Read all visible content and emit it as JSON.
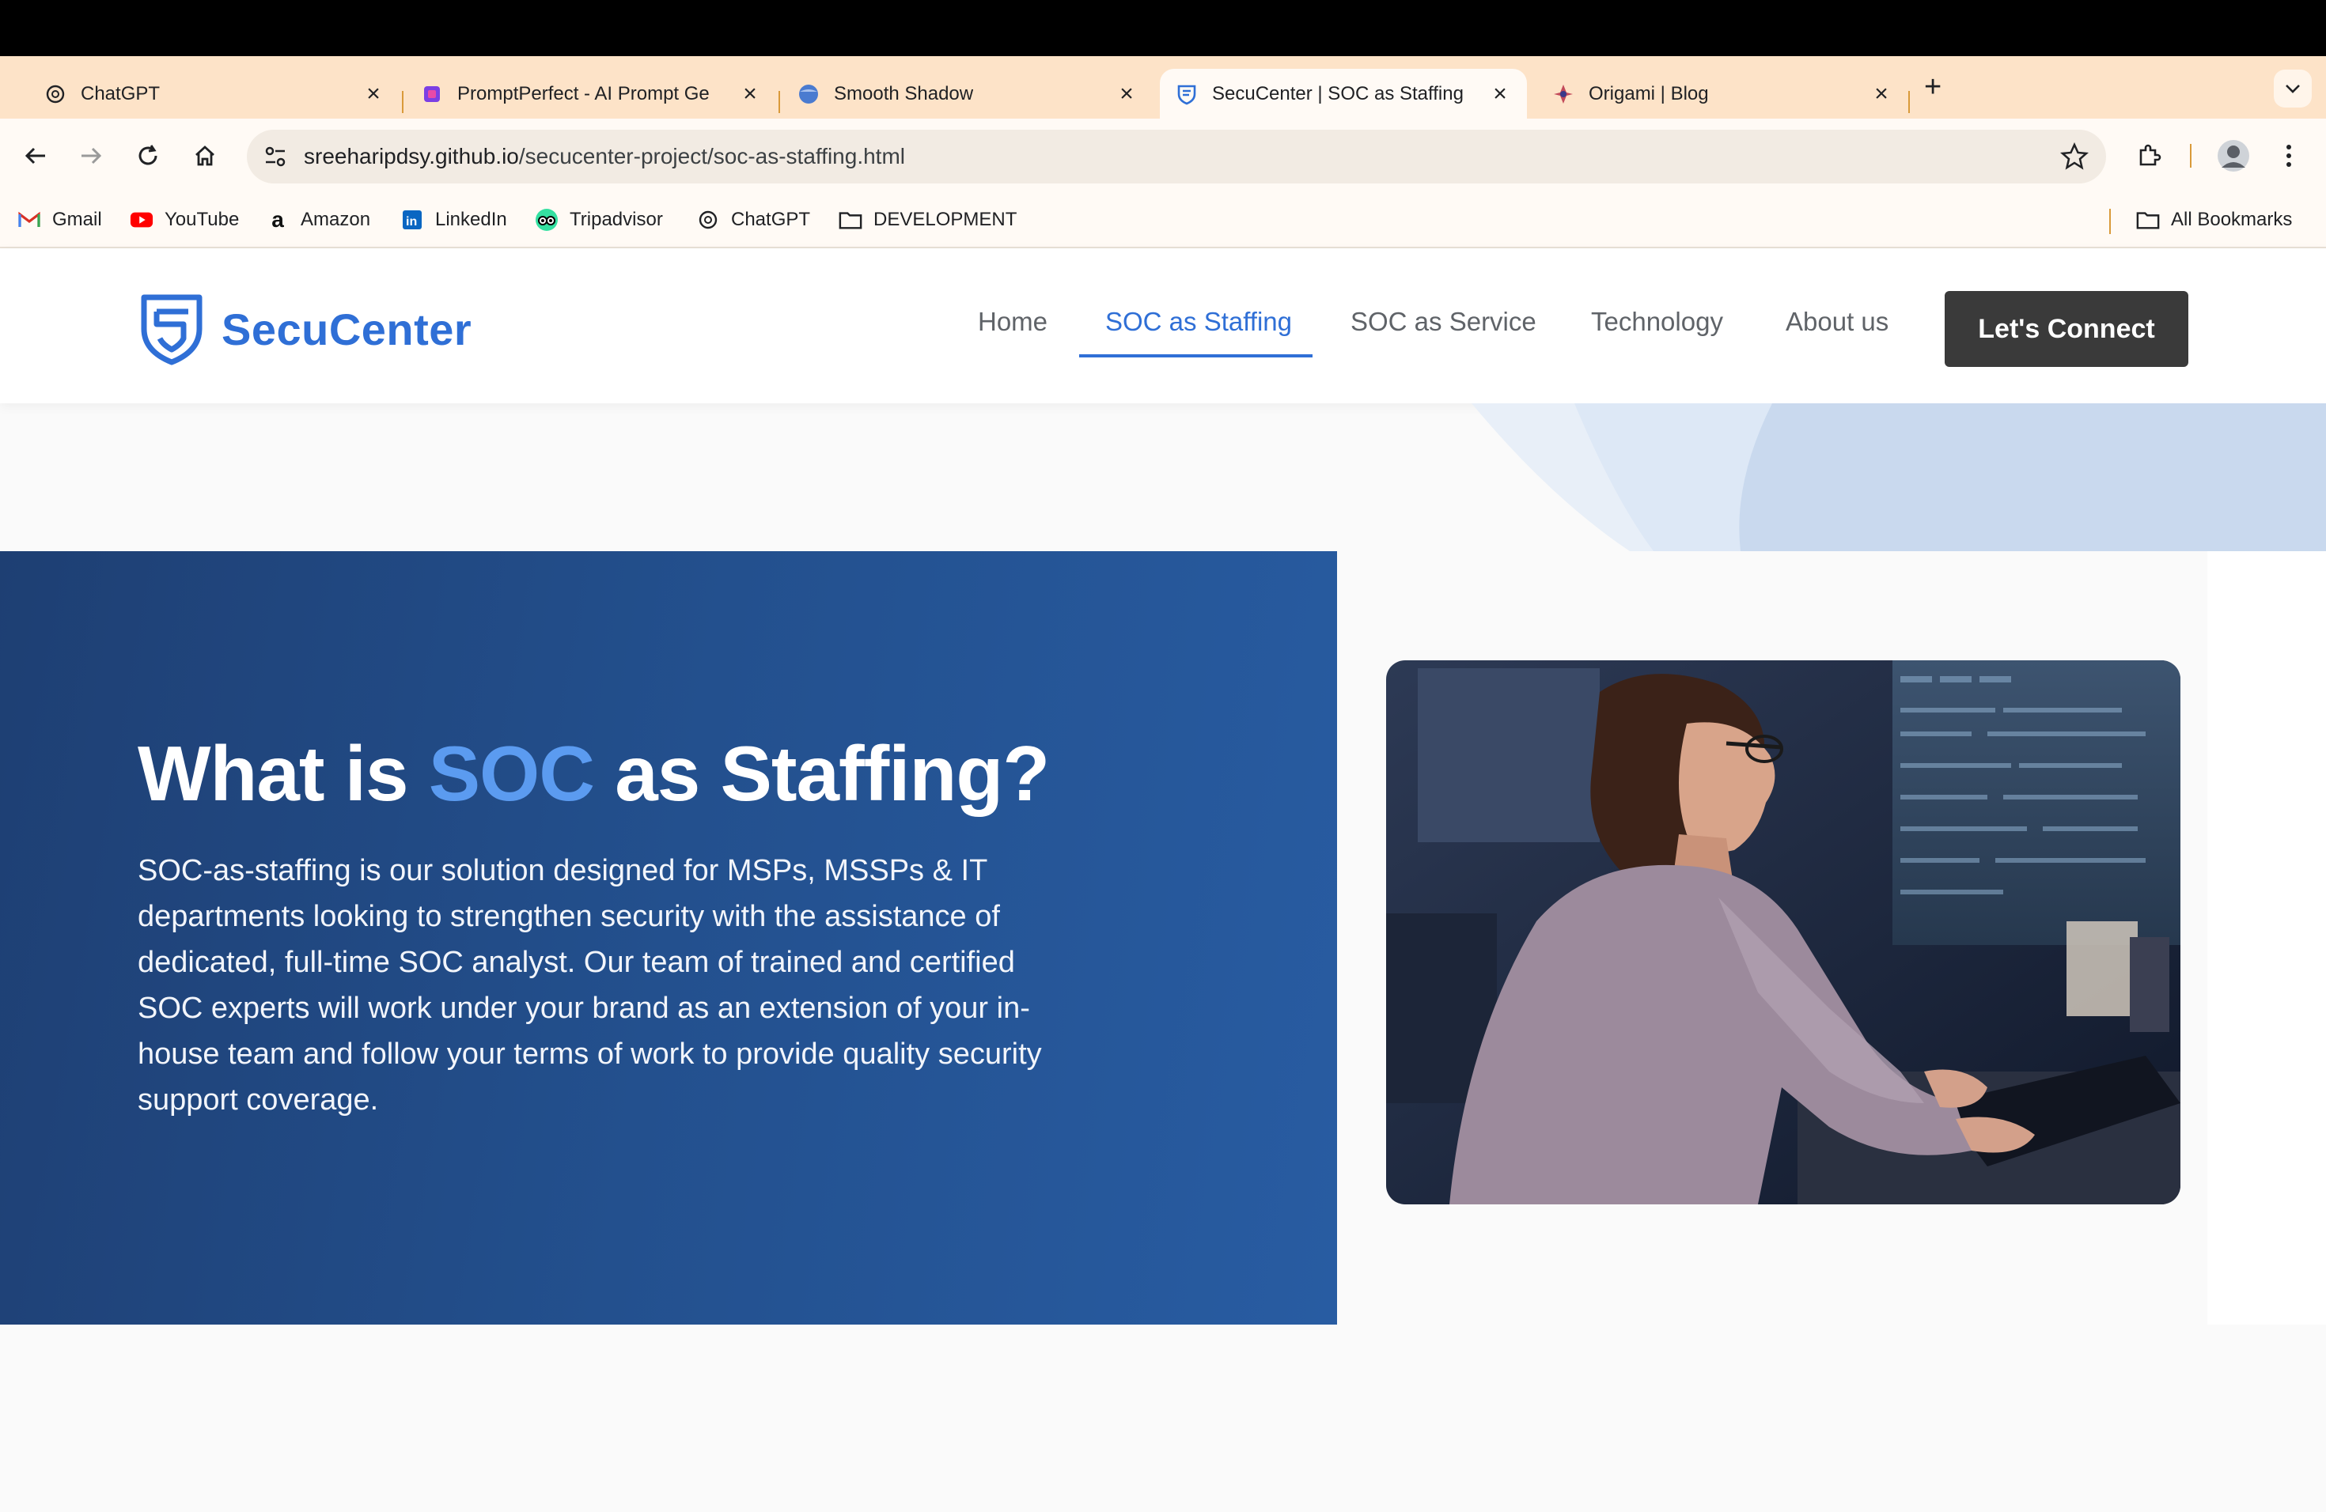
{
  "browser": {
    "tabs": [
      {
        "title": "ChatGPT",
        "icon": "openai-icon",
        "active": false
      },
      {
        "title": "PromptPerfect - AI Prompt Ge",
        "icon": "promptperfect-icon",
        "active": false
      },
      {
        "title": "Smooth Shadow",
        "icon": "smooth-shadow-icon",
        "active": false
      },
      {
        "title": "SecuCenter | SOC as Staffing",
        "icon": "secucenter-shield-icon",
        "active": true
      },
      {
        "title": "Origami | Blog",
        "icon": "origami-icon",
        "active": false
      }
    ],
    "url_host": "sreeharipdsy.github.io",
    "url_path": "/secucenter-project/soc-as-staffing.html",
    "bookmarks": [
      {
        "label": "Gmail",
        "icon": "gmail-icon"
      },
      {
        "label": "YouTube",
        "icon": "youtube-icon"
      },
      {
        "label": "Amazon",
        "icon": "amazon-icon"
      },
      {
        "label": "LinkedIn",
        "icon": "linkedin-icon"
      },
      {
        "label": "Tripadvisor",
        "icon": "tripadvisor-icon"
      },
      {
        "label": "ChatGPT",
        "icon": "openai-icon"
      },
      {
        "label": "DEVELOPMENT",
        "icon": "folder-icon"
      }
    ],
    "all_bookmarks": "All Bookmarks",
    "accent": "#fde3c8"
  },
  "site": {
    "logo_text": "SecuCenter",
    "nav": [
      {
        "label": "Home",
        "active": false
      },
      {
        "label": "SOC as Staffing",
        "active": true
      },
      {
        "label": "SOC as Service",
        "active": false
      },
      {
        "label": "Technology",
        "active": false
      },
      {
        "label": "About us",
        "active": false
      }
    ],
    "cta": "Let's Connect",
    "brand_color": "#2f6fd6"
  },
  "hero": {
    "title_before": "What is ",
    "title_accent": "SOC",
    "title_after": " as Staffing?",
    "body": "SOC-as-staffing is our solution designed for MSPs, MSSPs & IT departments looking to strengthen security with the assistance of dedicated, full-time SOC analyst. Our team of trained and certified SOC experts will work under your brand as an extension of your in-house team and follow your terms of work to provide quality security support coverage.",
    "image_alt": "analyst-at-monitors-photo"
  }
}
